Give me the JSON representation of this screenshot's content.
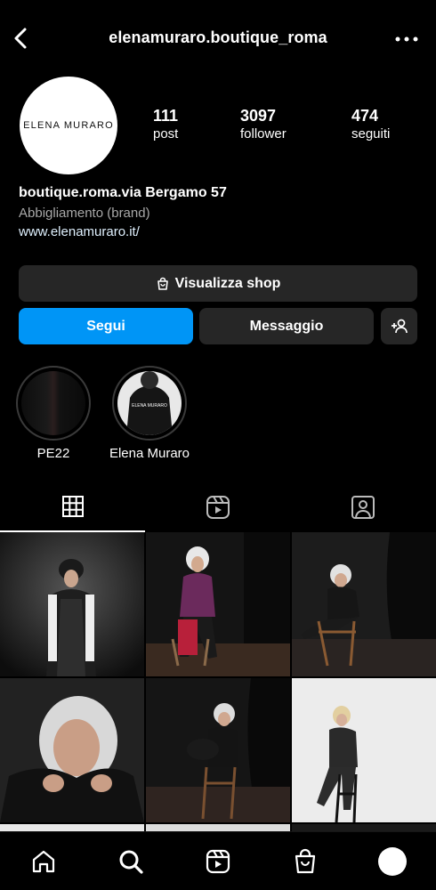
{
  "header": {
    "username": "elenamuraro.boutique_roma"
  },
  "profile": {
    "avatar_text": "ELENA MURARO",
    "stats": [
      {
        "value": "111",
        "label": "post"
      },
      {
        "value": "3097",
        "label": "follower"
      },
      {
        "value": "474",
        "label": "seguiti"
      }
    ],
    "bio_name": "boutique.roma.via Bergamo 57",
    "category": "Abbigliamento (brand)",
    "website": "www.elenamuraro.it/"
  },
  "actions": {
    "shop_label": "Visualizza shop",
    "follow_label": "Segui",
    "message_label": "Messaggio"
  },
  "highlights": [
    {
      "label": "PE22",
      "cover_text": ""
    },
    {
      "label": "Elena Muraro",
      "cover_text": "ELENA MURARO"
    }
  ],
  "tabs": [
    {
      "icon": "grid-icon",
      "active": true
    },
    {
      "icon": "reels-icon",
      "active": false
    },
    {
      "icon": "tagged-icon",
      "active": false
    }
  ],
  "posts": [
    {
      "subject": "woman with fur hat and long vest in dark setting"
    },
    {
      "subject": "woman in purple jacket seated on stool"
    },
    {
      "subject": "woman in black seated on wooden chair"
    },
    {
      "subject": "close-up of woman with grey hair in black turtleneck"
    },
    {
      "subject": "woman in black sitting on chair hugging knees"
    },
    {
      "subject": "woman in black on stool against white background"
    }
  ],
  "bottom_nav": [
    {
      "icon": "home-icon"
    },
    {
      "icon": "search-icon"
    },
    {
      "icon": "reels-icon"
    },
    {
      "icon": "shop-icon"
    },
    {
      "icon": "profile-icon"
    }
  ]
}
